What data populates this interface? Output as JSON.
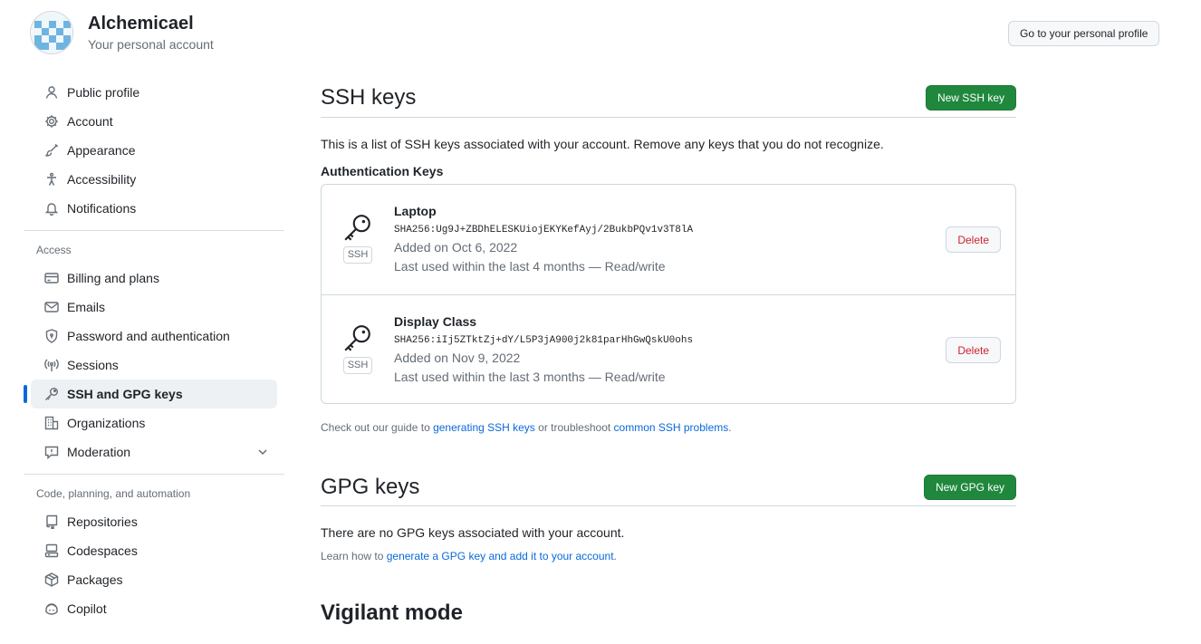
{
  "account": {
    "name": "Alchemicael",
    "subtitle": "Your personal account",
    "profile_button": "Go to your personal profile"
  },
  "sidebar": {
    "items": [
      {
        "label": "Public profile",
        "icon": "person-icon"
      },
      {
        "label": "Account",
        "icon": "gear-icon"
      },
      {
        "label": "Appearance",
        "icon": "paintbrush-icon"
      },
      {
        "label": "Accessibility",
        "icon": "accessibility-icon"
      },
      {
        "label": "Notifications",
        "icon": "bell-icon"
      }
    ],
    "access_title": "Access",
    "access_items": [
      {
        "label": "Billing and plans",
        "icon": "credit-card-icon"
      },
      {
        "label": "Emails",
        "icon": "mail-icon"
      },
      {
        "label": "Password and authentication",
        "icon": "shield-lock-icon"
      },
      {
        "label": "Sessions",
        "icon": "broadcast-icon"
      },
      {
        "label": "SSH and GPG keys",
        "icon": "key-icon",
        "active": true
      },
      {
        "label": "Organizations",
        "icon": "organization-icon"
      },
      {
        "label": "Moderation",
        "icon": "report-icon"
      }
    ],
    "code_title": "Code, planning, and automation",
    "code_items": [
      {
        "label": "Repositories",
        "icon": "repo-icon"
      },
      {
        "label": "Codespaces",
        "icon": "codespaces-icon"
      },
      {
        "label": "Packages",
        "icon": "package-icon"
      },
      {
        "label": "Copilot",
        "icon": "copilot-icon"
      }
    ]
  },
  "ssh": {
    "title": "SSH keys",
    "new_button": "New SSH key",
    "description": "This is a list of SSH keys associated with your account. Remove any keys that you do not recognize.",
    "auth_title": "Authentication Keys",
    "keys": [
      {
        "title": "Laptop",
        "badge": "SSH",
        "fingerprint": "SHA256:Ug9J+ZBDhELESKUiojEKYKefAyj/2BukbPQv1v3T8lA",
        "added": "Added on Oct 6, 2022",
        "used": "Last used within the last 4 months — Read/write",
        "delete": "Delete"
      },
      {
        "title": "Display Class",
        "badge": "SSH",
        "fingerprint": "SHA256:iIj5ZTktZj+dY/L5P3jA900j2k81parHhGwQskU0ohs",
        "added": "Added on Nov 9, 2022",
        "used": "Last used within the last 3 months — Read/write",
        "delete": "Delete"
      }
    ],
    "help_prefix": "Check out our guide to ",
    "help_link1": "generating SSH keys",
    "help_mid": " or troubleshoot ",
    "help_link2": "common SSH problems",
    "help_suffix": "."
  },
  "gpg": {
    "title": "GPG keys",
    "new_button": "New GPG key",
    "description": "There are no GPG keys associated with your account.",
    "help_prefix": "Learn how to ",
    "help_link": "generate a GPG key and add it to your account",
    "help_suffix": "."
  },
  "vigilant": {
    "title": "Vigilant mode"
  },
  "colors": {
    "accent": "#0969da",
    "green": "#1f883d",
    "danger": "#cf222e"
  }
}
